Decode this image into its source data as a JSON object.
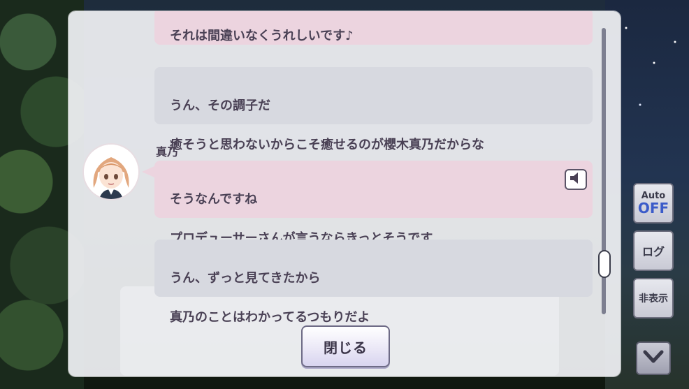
{
  "messages": [
    {
      "lines": [
        "それは間違いなくうれしいです♪"
      ],
      "style": "pink"
    },
    {
      "lines": [
        "うん、その調子だ",
        "癒そうと思わないからこそ癒せるのが櫻木真乃だからな"
      ],
      "style": "grey"
    },
    {
      "speaker": "真乃",
      "lines": [
        "そうなんですね",
        "プロデューサーさんが言うならきっとそうです"
      ],
      "style": "pink"
    },
    {
      "lines": [
        "うん、ずっと見てきたから",
        "真乃のことはわかってるつもりだよ"
      ],
      "style": "grey"
    }
  ],
  "close_label": "閉じる",
  "side_controls": {
    "auto_label": "Auto",
    "auto_state": "OFF",
    "log_label": "ログ",
    "hide_label": "非表示"
  },
  "colors": {
    "pink_bubble": "#ecd4df",
    "grey_bubble": "#d7d9e0",
    "auto_off": "#3b5bc9"
  },
  "icons": [
    "speaker-icon",
    "chevron-down-icon"
  ]
}
